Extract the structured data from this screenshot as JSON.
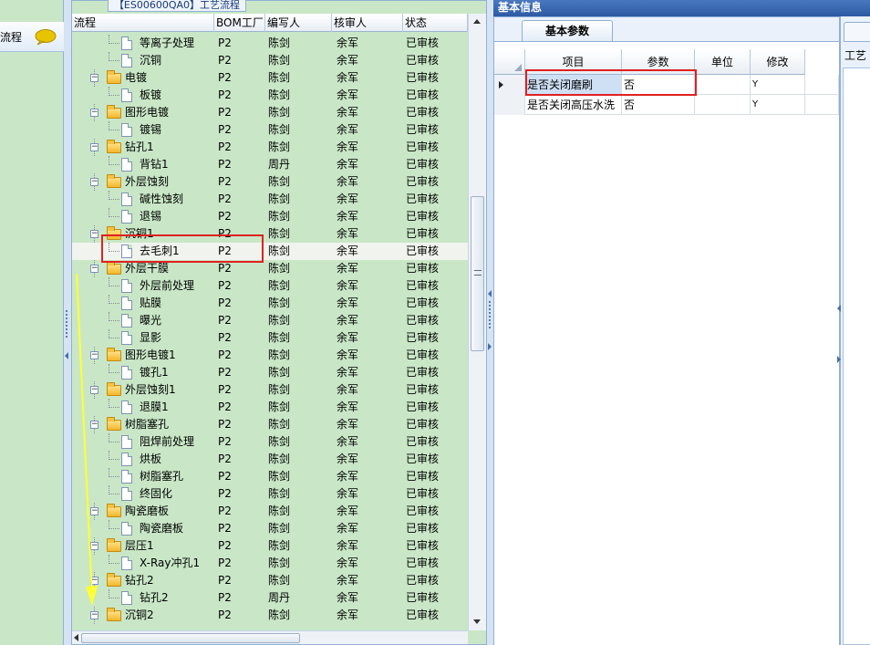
{
  "left_panel": {
    "header": "流程"
  },
  "top_tab": {
    "title": "【ES00600QA0】工艺流程"
  },
  "tree": {
    "columns": [
      "流程",
      "BOM工厂",
      "编写人",
      "核审人",
      "状态"
    ],
    "rows": [
      {
        "level": 2,
        "name": "等离子处理",
        "bom": "P2",
        "writer": "陈剑",
        "reviewer": "余军",
        "status": "已审核"
      },
      {
        "level": 2,
        "name": "沉铜",
        "bom": "P2",
        "writer": "陈剑",
        "reviewer": "余军",
        "status": "已审核"
      },
      {
        "level": 1,
        "name": "电镀",
        "bom": "P2",
        "writer": "陈剑",
        "reviewer": "余军",
        "status": "已审核"
      },
      {
        "level": 2,
        "name": "板镀",
        "bom": "P2",
        "writer": "陈剑",
        "reviewer": "余军",
        "status": "已审核"
      },
      {
        "level": 1,
        "name": "图形电镀",
        "bom": "P2",
        "writer": "陈剑",
        "reviewer": "余军",
        "status": "已审核"
      },
      {
        "level": 2,
        "name": "镀锡",
        "bom": "P2",
        "writer": "陈剑",
        "reviewer": "余军",
        "status": "已审核"
      },
      {
        "level": 1,
        "name": "钻孔1",
        "bom": "P2",
        "writer": "陈剑",
        "reviewer": "余军",
        "status": "已审核"
      },
      {
        "level": 2,
        "name": "背钻1",
        "bom": "P2",
        "writer": "周丹",
        "reviewer": "余军",
        "status": "已审核"
      },
      {
        "level": 1,
        "name": "外层蚀刻",
        "bom": "P2",
        "writer": "陈剑",
        "reviewer": "余军",
        "status": "已审核"
      },
      {
        "level": 2,
        "name": "碱性蚀刻",
        "bom": "P2",
        "writer": "陈剑",
        "reviewer": "余军",
        "status": "已审核"
      },
      {
        "level": 2,
        "name": "退锡",
        "bom": "P2",
        "writer": "陈剑",
        "reviewer": "余军",
        "status": "已审核"
      },
      {
        "level": 1,
        "name": "沉铜1",
        "bom": "P2",
        "writer": "陈剑",
        "reviewer": "余军",
        "status": "已审核"
      },
      {
        "level": 2,
        "name": "去毛刺1",
        "bom": "P2",
        "writer": "陈剑",
        "reviewer": "余军",
        "status": "已审核"
      },
      {
        "level": 1,
        "name": "外层干膜",
        "bom": "P2",
        "writer": "陈剑",
        "reviewer": "余军",
        "status": "已审核"
      },
      {
        "level": 2,
        "name": "外层前处理",
        "bom": "P2",
        "writer": "陈剑",
        "reviewer": "余军",
        "status": "已审核"
      },
      {
        "level": 2,
        "name": "贴膜",
        "bom": "P2",
        "writer": "陈剑",
        "reviewer": "余军",
        "status": "已审核"
      },
      {
        "level": 2,
        "name": "曝光",
        "bom": "P2",
        "writer": "陈剑",
        "reviewer": "余军",
        "status": "已审核"
      },
      {
        "level": 2,
        "name": "显影",
        "bom": "P2",
        "writer": "陈剑",
        "reviewer": "余军",
        "status": "已审核"
      },
      {
        "level": 1,
        "name": "图形电镀1",
        "bom": "P2",
        "writer": "陈剑",
        "reviewer": "余军",
        "status": "已审核"
      },
      {
        "level": 2,
        "name": "镀孔1",
        "bom": "P2",
        "writer": "陈剑",
        "reviewer": "余军",
        "status": "已审核"
      },
      {
        "level": 1,
        "name": "外层蚀刻1",
        "bom": "P2",
        "writer": "陈剑",
        "reviewer": "余军",
        "status": "已审核"
      },
      {
        "level": 2,
        "name": "退膜1",
        "bom": "P2",
        "writer": "陈剑",
        "reviewer": "余军",
        "status": "已审核"
      },
      {
        "level": 1,
        "name": "树脂塞孔",
        "bom": "P2",
        "writer": "陈剑",
        "reviewer": "余军",
        "status": "已审核"
      },
      {
        "level": 2,
        "name": "阻焊前处理",
        "bom": "P2",
        "writer": "陈剑",
        "reviewer": "余军",
        "status": "已审核"
      },
      {
        "level": 2,
        "name": "烘板",
        "bom": "P2",
        "writer": "陈剑",
        "reviewer": "余军",
        "status": "已审核"
      },
      {
        "level": 2,
        "name": "树脂塞孔",
        "bom": "P2",
        "writer": "陈剑",
        "reviewer": "余军",
        "status": "已审核"
      },
      {
        "level": 2,
        "name": "终固化",
        "bom": "P2",
        "writer": "陈剑",
        "reviewer": "余军",
        "status": "已审核"
      },
      {
        "level": 1,
        "name": "陶瓷磨板",
        "bom": "P2",
        "writer": "陈剑",
        "reviewer": "余军",
        "status": "已审核"
      },
      {
        "level": 2,
        "name": "陶瓷磨板",
        "bom": "P2",
        "writer": "陈剑",
        "reviewer": "余军",
        "status": "已审核"
      },
      {
        "level": 1,
        "name": "层压1",
        "bom": "P2",
        "writer": "陈剑",
        "reviewer": "余军",
        "status": "已审核"
      },
      {
        "level": 2,
        "name": "X-Ray冲孔1",
        "bom": "P2",
        "writer": "陈剑",
        "reviewer": "余军",
        "status": "已审核"
      },
      {
        "level": 1,
        "name": "钻孔2",
        "bom": "P2",
        "writer": "陈剑",
        "reviewer": "余军",
        "status": "已审核"
      },
      {
        "level": 2,
        "name": "钻孔2",
        "bom": "P2",
        "writer": "周丹",
        "reviewer": "余军",
        "status": "已审核"
      },
      {
        "level": 1,
        "name": "沉铜2",
        "bom": "P2",
        "writer": "陈剑",
        "reviewer": "余军",
        "status": "已审核"
      }
    ]
  },
  "basic_info": {
    "header": "基本信息",
    "tab": "基本参数",
    "columns": [
      "项目",
      "参数",
      "单位",
      "修改"
    ],
    "rows": [
      {
        "item": "是否关闭磨刷",
        "param": "否",
        "unit": "",
        "modify": "Y"
      },
      {
        "item": "是否关闭高压水洗",
        "param": "否",
        "unit": "",
        "modify": "Y"
      }
    ]
  },
  "far_right": {
    "label": "工艺"
  },
  "colors": {
    "tree_bg": "#c9e7c7",
    "header_blue": "#2d5aa3",
    "highlight_red": "#e02020",
    "annotation_yellow": "#ffff33"
  }
}
